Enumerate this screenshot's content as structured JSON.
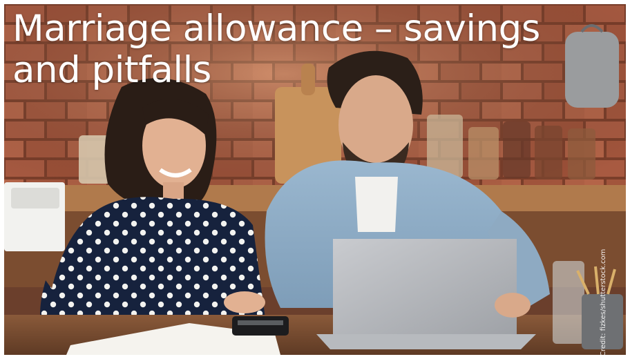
{
  "headline": "Marriage allowance – savings and pitfalls",
  "credit": "Credit: fizkes/shutterstock.com"
}
